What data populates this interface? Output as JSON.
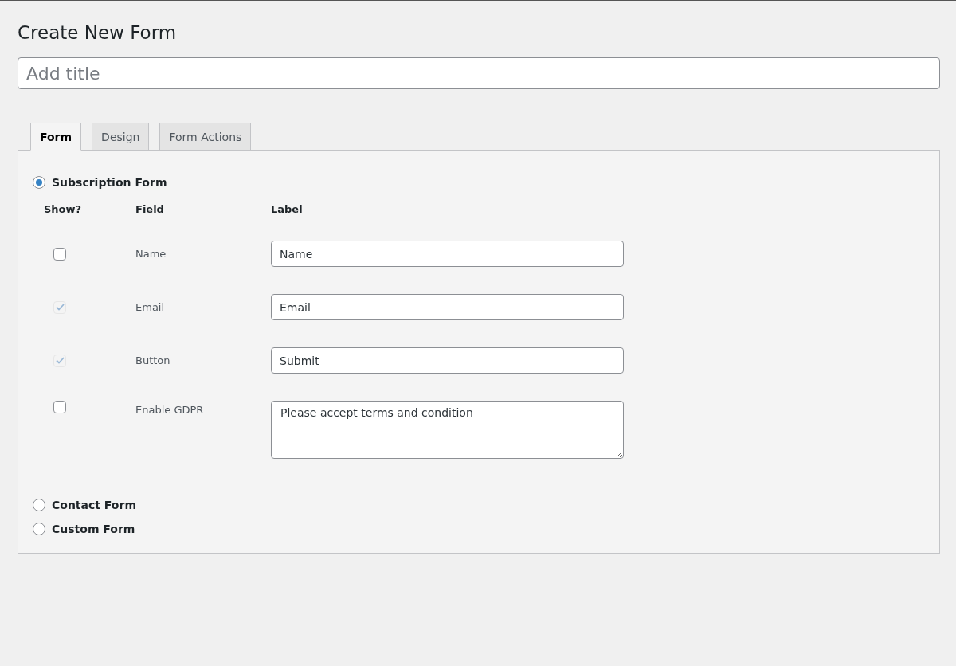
{
  "page_title": "Create New Form",
  "title_field": {
    "placeholder": "Add title"
  },
  "tabs": [
    {
      "label": "Form",
      "selected": true
    },
    {
      "label": "Design",
      "selected": false
    },
    {
      "label": "Form Actions",
      "selected": false
    }
  ],
  "form_types": [
    {
      "label": "Subscription Form",
      "selected": true,
      "columns": [
        "Show?",
        "Field",
        "Label"
      ],
      "fields": [
        {
          "field": "Name",
          "kind": "input",
          "value": "Name",
          "checked": false,
          "disabled": false
        },
        {
          "field": "Email",
          "kind": "input",
          "value": "Email",
          "checked": true,
          "disabled": true
        },
        {
          "field": "Button",
          "kind": "input",
          "value": "Submit",
          "checked": true,
          "disabled": true
        },
        {
          "field": "Enable GDPR",
          "kind": "textarea",
          "value": "Please accept terms and condition",
          "checked": false,
          "disabled": false
        }
      ]
    },
    {
      "label": "Contact Form",
      "selected": false
    },
    {
      "label": "Custom Form",
      "selected": false
    }
  ]
}
